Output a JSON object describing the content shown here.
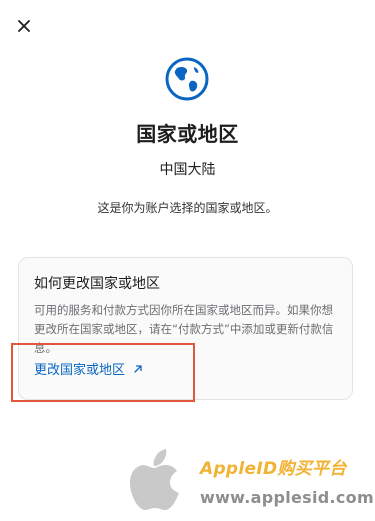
{
  "dialog": {
    "close_icon": "close-icon",
    "globe_icon": "globe-icon",
    "title": "国家或地区",
    "country": "中国大陆",
    "description": "这是你为账户选择的国家或地区。"
  },
  "card": {
    "title": "如何更改国家或地区",
    "text": "可用的服务和付款方式因你所在国家或地区而异。如果你想更改所在国家或地区，请在“付款方式”中添加或更新付款信息。",
    "link_label": "更改国家或地区",
    "link_icon": "arrow-up-right-icon"
  },
  "watermark": {
    "brand": "AppleID购买平台",
    "url": "www.applesid.com",
    "logo_icon": "apple-logo-icon"
  },
  "colors": {
    "accent": "#0a66c2",
    "highlight": "#e0583a",
    "watermark_brand": "#f2b233"
  }
}
